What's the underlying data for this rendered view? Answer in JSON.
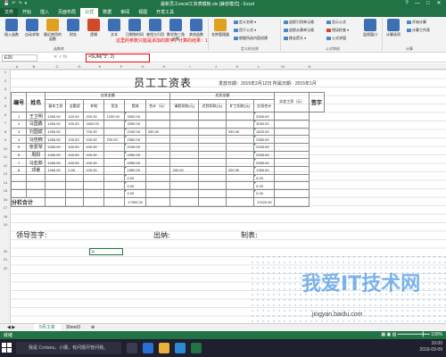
{
  "window": {
    "title": "最新员工excel工资表模板.xls [兼容模式] - Excel",
    "controls": [
      "?",
      "—",
      "□",
      "✕"
    ]
  },
  "quick_access": [
    "💾",
    "↶",
    "↷",
    "▾"
  ],
  "ribbon_tabs": [
    "文件",
    "开始",
    "插入",
    "页面布局",
    "公式",
    "数据",
    "审阅",
    "视图",
    "开发工具"
  ],
  "ribbon": {
    "big_buttons": [
      {
        "label": "插入函数",
        "color": "#3c6fb4"
      },
      {
        "label": "自动求和",
        "color": "#3c6fb4"
      },
      {
        "label": "最近使用的函数",
        "color": "#e0a020"
      },
      {
        "label": "财务",
        "color": "#3c6fb4"
      },
      {
        "label": "逻辑",
        "color": "#d04a2a"
      },
      {
        "label": "文本",
        "color": "#3c6fb4"
      },
      {
        "label": "日期和时间",
        "color": "#3c6fb4"
      },
      {
        "label": "查找与引用",
        "color": "#3c6fb4"
      },
      {
        "label": "数学和三角函数",
        "color": "#3c6fb4"
      },
      {
        "label": "其他函数",
        "color": "#3c6fb4"
      },
      {
        "label": "名称管理器",
        "color": "#e0a020"
      }
    ],
    "small_buttons": [
      "定义名称 ▾",
      "用于公式 ▾",
      "根据所选内容创建",
      "追踪引用单元格",
      "追踪从属单元格",
      "移去箭头 ▾",
      "显示公式",
      "错误检查 ▾",
      "公式求值",
      "监视窗口",
      "计算选项",
      "开始计算",
      "计算工作表"
    ],
    "group_labels": [
      "函数库",
      "定义的名称",
      "公式审核",
      "计算"
    ],
    "warning": "这里的参数只能是添加的数字，计算的结果：1"
  },
  "formula_bar": {
    "name_box": "E20",
    "icons": "✕ ✓ fx",
    "formula": "=SUM(\"3\", 2)"
  },
  "column_headers": [
    "A",
    "B",
    "C",
    "D",
    "E",
    "F",
    "G",
    "H",
    "I",
    "J",
    "K",
    "L",
    "M",
    "N"
  ],
  "row_headers": [
    "1",
    "2",
    "3",
    "4",
    "5",
    "6",
    "7",
    "8",
    "9",
    "10",
    "11",
    "12",
    "13",
    "14",
    "15",
    "16",
    "17",
    "18",
    "19",
    "20",
    "21",
    "22"
  ],
  "sheet": {
    "title": "员工工资表",
    "issue_date": "发放日期：2015年2月12日 所属日期：2015年1月",
    "header_row1": [
      "编号",
      "姓名",
      "应发金额",
      "应扣金额",
      "实发工资（元）",
      "签字"
    ],
    "header_row2": [
      "基本工资",
      "全勤奖",
      "补助",
      "奖金",
      "提成",
      "合计（元）",
      "请假扣款(元)",
      "迟到扣款(元)",
      "旷工扣款(元)",
      "应扣合计"
    ],
    "rows": [
      [
        "1",
        "王卫明",
        "1450.00",
        "120.00",
        "200.00",
        "1200.00",
        "3300.00",
        "",
        "",
        "",
        "",
        "3300.00",
        ""
      ],
      [
        "2",
        "马国鑫",
        "1450.00",
        "100.00",
        "1600.00",
        "",
        "3250.00",
        "",
        "",
        "",
        "",
        "3250.00",
        ""
      ],
      [
        "3",
        "刘国斌",
        "1450.00",
        "",
        "700.00",
        "",
        "2150.00",
        "330.00",
        "",
        "",
        "330.00",
        "1820.00",
        ""
      ],
      [
        "4",
        "马佳楠",
        "1450.00",
        "100.00",
        "100.00",
        "700.00",
        "2350.00",
        "",
        "",
        "",
        "",
        "2350.00",
        ""
      ],
      [
        "5",
        "张爱琴",
        "1450.00",
        "100.00",
        "100.00",
        "",
        "2100.00",
        "",
        "",
        "",
        "",
        "2100.00",
        ""
      ],
      [
        "6",
        "周阳",
        "1450.00",
        "100.00",
        "100.00",
        "",
        "2250.00",
        "",
        "",
        "",
        "",
        "2250.00",
        ""
      ],
      [
        "7",
        "马亚茹",
        "1450.00",
        "100.00",
        "100.00",
        "",
        "2250.00",
        "",
        "",
        "",
        "",
        "2250.00",
        ""
      ],
      [
        "8",
        "邓睿",
        "1450.00",
        "0.00",
        "100.00",
        "",
        "1550.00",
        "",
        "200.00",
        "",
        "200.00",
        "1350.00",
        ""
      ],
      [
        "",
        "",
        "",
        "",
        "",
        "",
        "0.00",
        "",
        "",
        "",
        "",
        "0.00",
        ""
      ],
      [
        "",
        "",
        "",
        "",
        "",
        "",
        "0.00",
        "",
        "",
        "",
        "",
        "0.00",
        ""
      ],
      [
        "",
        "",
        "",
        "",
        "",
        "",
        "0.00",
        "",
        "",
        "",
        "",
        "0.00",
        ""
      ]
    ],
    "subtotal_label": "分栏合计",
    "subtotal_value": "17900.00",
    "subtotal_net": "17420.00",
    "footer": {
      "leader": "领导签字:",
      "cashier": "出纳:",
      "maker": "制表:"
    },
    "selected_cell_value": "11"
  },
  "sheet_tabs": [
    "5月工资",
    "Sheet3",
    "⊕"
  ],
  "status": {
    "left": "就绪",
    "right": "▦ ▣ ▥  ━━━━━━━━━╋━━  100%"
  },
  "taskbar": {
    "search": "我是 Cortana，小娜。有问题尽管问我。",
    "time": "16:00",
    "date": "2016-03-09"
  },
  "watermark": {
    "logo": "我爱IT技术网",
    "url": "jingyan.baidu.com"
  }
}
